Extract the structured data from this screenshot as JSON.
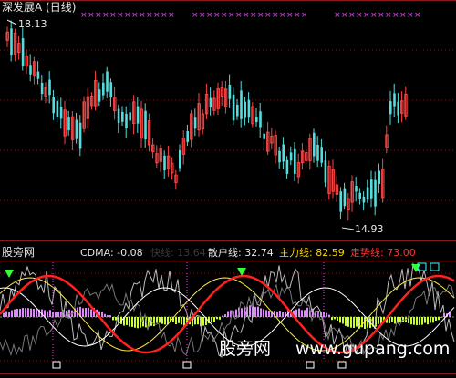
{
  "header": {
    "title": "深发展A (日线)",
    "title_color": "#e6e6e6"
  },
  "price_panel": {
    "high_label": "18.13",
    "low_label": "14.93",
    "marker_glyph": "×",
    "marker_color": "#ff33ff",
    "up_color": "#ff4444",
    "down_color": "#55dddd"
  },
  "indicator_panel": {
    "logo_text": "股旁网",
    "items": [
      {
        "label": "CDMA: -0.08",
        "color": "#e6e6e6"
      },
      {
        "label": "快线: 13.64",
        "color": "#333333"
      },
      {
        "label": "散户线: 32.74",
        "color": "#e6e6e6"
      },
      {
        "label": "主力线: 82.59",
        "color": "#ffd700"
      },
      {
        "label": "走势线: 73.00",
        "color": "#ff3333"
      }
    ]
  },
  "watermark": {
    "text": "股旁网",
    "url": "www.gupang.com"
  }
}
